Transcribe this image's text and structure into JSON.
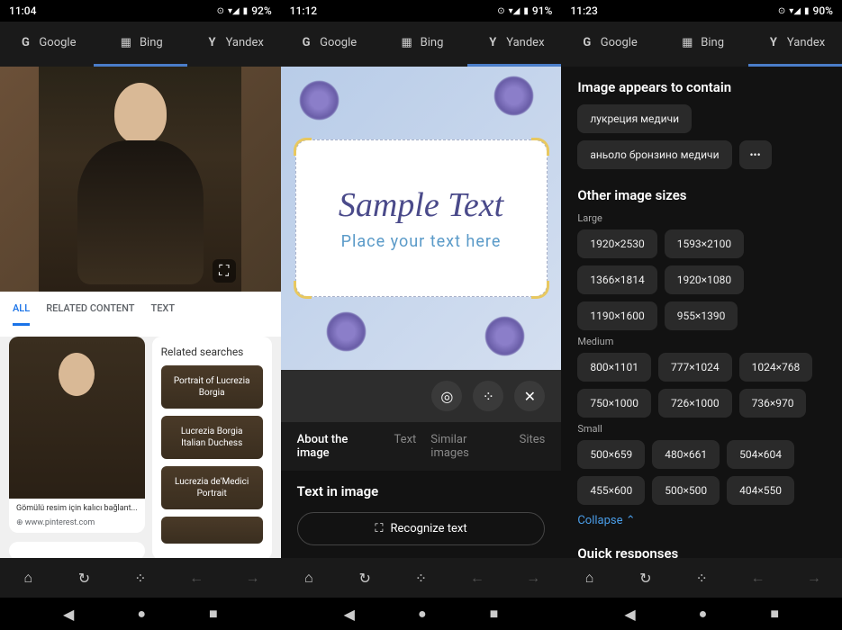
{
  "panel1": {
    "status": {
      "time": "11:04",
      "battery": "92%"
    },
    "tabs": [
      {
        "label": "Google",
        "icon": "G"
      },
      {
        "label": "Bing",
        "icon": "⊞"
      },
      {
        "label": "Yandex",
        "icon": "Y"
      }
    ],
    "active_tab": 1,
    "sub_tabs": [
      "ALL",
      "RELATED CONTENT",
      "TEXT"
    ],
    "active_sub_tab": 0,
    "thumb": {
      "caption": "Gömülü resim için kalıcı bağlant...",
      "source": "www.pinterest.com"
    },
    "related_searches_title": "Related searches",
    "related_chips": [
      "Portrait of Lucrezia Borgia",
      "Lucrezia Borgia Italian Duchess",
      "Lucrezia de'Medici Portrait"
    ]
  },
  "panel2": {
    "status": {
      "time": "11:12",
      "battery": "91%"
    },
    "tabs": [
      {
        "label": "Google",
        "icon": "G"
      },
      {
        "label": "Bing",
        "icon": "⊞"
      },
      {
        "label": "Yandex",
        "icon": "Y"
      }
    ],
    "active_tab": 2,
    "sample_text": "Sample Text",
    "sub_text": "Place your text here",
    "info_tabs": [
      "About the image",
      "Text",
      "Similar images",
      "Sites"
    ],
    "active_info_tab": 0,
    "text_in_image_heading": "Text in image",
    "recognize_label": "Recognize text"
  },
  "panel3": {
    "status": {
      "time": "11:23",
      "battery": "90%"
    },
    "tabs": [
      {
        "label": "Google",
        "icon": "G"
      },
      {
        "label": "Bing",
        "icon": "⊞"
      },
      {
        "label": "Yandex",
        "icon": "Y"
      }
    ],
    "active_tab": 2,
    "contains_title": "Image appears to contain",
    "contains_chips": [
      "лукреция медичи",
      "аньоло бронзино медичи"
    ],
    "more_label": "•••",
    "sizes_title": "Other image sizes",
    "size_groups": {
      "Large": [
        "1920×2530",
        "1593×2100",
        "1366×1814",
        "1920×1080",
        "1190×1600",
        "955×1390"
      ],
      "Medium": [
        "800×1101",
        "777×1024",
        "1024×768",
        "750×1000",
        "726×1000",
        "736×970"
      ],
      "Small": [
        "500×659",
        "480×661",
        "504×604",
        "455×600",
        "500×500",
        "404×550"
      ]
    },
    "collapse_label": "Collapse ⌃",
    "quick_responses_title": "Quick responses"
  }
}
